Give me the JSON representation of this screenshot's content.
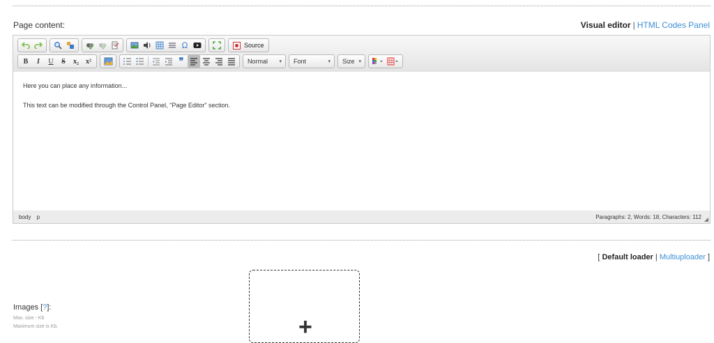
{
  "page_content_label": "Page content:",
  "mode_switch": {
    "active": "Visual editor",
    "separator": "|",
    "other": "HTML Codes Panel"
  },
  "toolbar": {
    "row1": [
      "undo-icon",
      "redo-icon",
      "find-icon",
      "replace-icon",
      "spellcheck-icon",
      "spellcheck-off-icon",
      "scayt-icon",
      "image-icon",
      "flash-icon",
      "table-icon",
      "horizontal-rule-icon",
      "special-char-icon",
      "youtube-icon",
      "maximize-icon",
      "source-icon"
    ],
    "source_label": "Source",
    "row2_buttons": [
      "B",
      "I",
      "U",
      "S",
      "x₂",
      "x²"
    ],
    "combos": {
      "format": "Normal",
      "font": "Font",
      "size": "Size"
    }
  },
  "content": {
    "line1": "Here you can place any information...",
    "line2": "This text can be modified through the Control Panel, \"Page Editor\" section."
  },
  "status": {
    "path": [
      "body",
      "p"
    ],
    "counts": "Paragraphs: 2, Words: 18, Characters: 112"
  },
  "loader_switch": {
    "open": "[",
    "active": "Default loader",
    "separator": "|",
    "other": "Multiuploader",
    "close": "]"
  },
  "images": {
    "label": "Images",
    "help_open": "[",
    "help": "?",
    "help_close": "]",
    "colon": ":",
    "max_size": "Max. size - Kb",
    "maximum_size": "Maximum size is Kb."
  },
  "dropzone": {
    "plus": "+"
  }
}
